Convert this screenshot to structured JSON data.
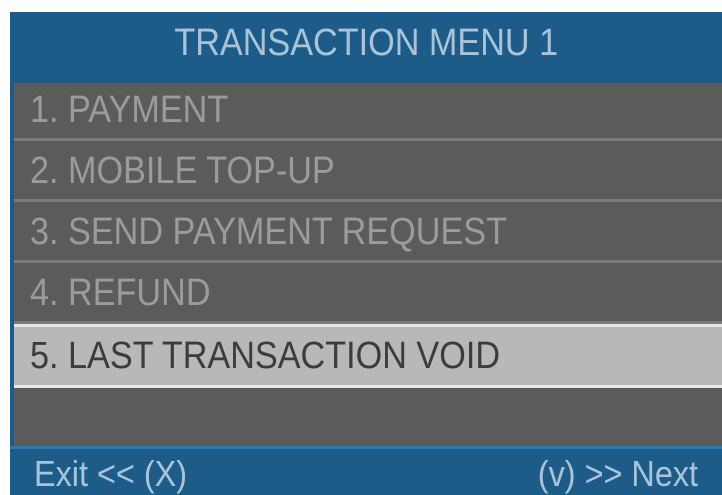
{
  "header": {
    "title": "TRANSACTION MENU 1"
  },
  "menu": {
    "items": [
      {
        "label": "1. PAYMENT"
      },
      {
        "label": "2. MOBILE TOP-UP"
      },
      {
        "label": "3. SEND PAYMENT REQUEST"
      },
      {
        "label": "4. REFUND"
      },
      {
        "label": "5. LAST TRANSACTION VOID"
      }
    ],
    "selected_index": 4
  },
  "footer": {
    "exit_label": "Exit << (X)",
    "next_label": "(v) >> Next"
  },
  "colors": {
    "frame_blue": "#1d5c88",
    "menu_gray": "#5b5b5b",
    "selected_gray": "#b8b8b8",
    "text_light_blue": "#a9c4d8"
  }
}
